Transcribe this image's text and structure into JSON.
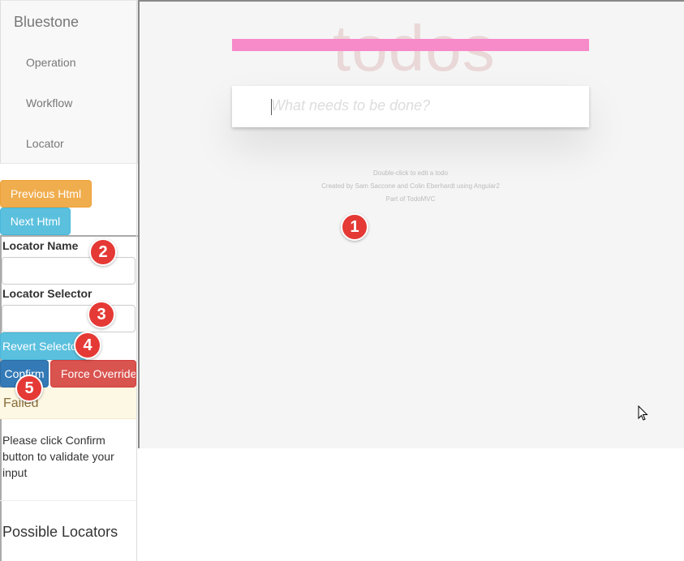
{
  "sidebar": {
    "brand": "Bluestone",
    "nav_items": [
      {
        "label": "Operation"
      },
      {
        "label": "Workflow"
      },
      {
        "label": "Locator"
      }
    ],
    "previous_html_label": "Previous Html",
    "next_html_label": "Next Html",
    "locator_name_label": "Locator Name",
    "locator_name_value": "",
    "locator_selector_label": "Locator Selector",
    "locator_selector_value": "",
    "revert_selector_label": "Revert Selector",
    "confirm_label": "Confirm",
    "force_override_label": "Force Override",
    "status_text": "Failed",
    "hint_text": "Please click Confirm button to validate your input",
    "possible_locators_title": "Possible Locators"
  },
  "main": {
    "app_title": "todos",
    "new_todo_placeholder": "What needs to be done?",
    "footer_lines": [
      "Double-click to edit a todo",
      "Created by Sam Saccone and Colin Eberhardt using Angular2",
      "Part of TodoMVC"
    ]
  },
  "markers": [
    "1",
    "2",
    "3",
    "4",
    "5"
  ],
  "colors": {
    "warning": "#f0ad4e",
    "info": "#5bc0de",
    "primary": "#337ab7",
    "danger": "#d9534f",
    "highlight_bar": "#f78ac8",
    "marker": "#e53935"
  }
}
